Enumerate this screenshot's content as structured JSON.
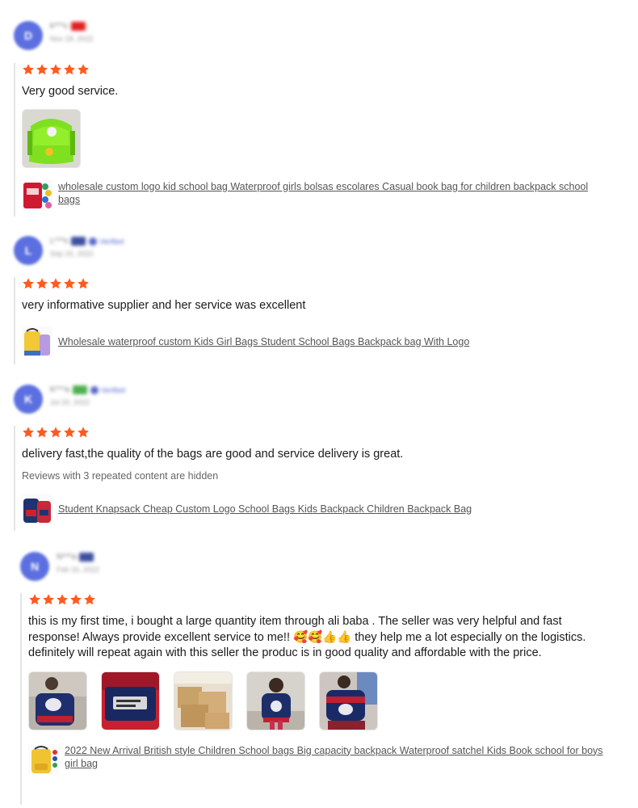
{
  "reviews": [
    {
      "avatar_letter": "D",
      "name": "k***s",
      "date": "Nov 18, 2022",
      "flag_color": "#e02020",
      "verified_badge": "",
      "rating": 5,
      "text": "Very good service.",
      "product_link": "wholesale custom logo kid school bag Waterproof girls bolsas escolares Casual book bag for children backpack school bags",
      "has_photos": true
    },
    {
      "avatar_letter": "L",
      "name": "L***s",
      "date": "Sep 15, 2022",
      "flag_color": "#3c4fa0",
      "verified_badge": "Verified",
      "rating": 5,
      "text": "very informative supplier and her service was excellent",
      "product_link": "Wholesale waterproof custom Kids Girl Bags Student School Bags Backpack bag With Logo"
    },
    {
      "avatar_letter": "K",
      "name": "K***a",
      "date": "Jul 20, 2022",
      "flag_color": "#4caf50",
      "verified_badge": "Verified",
      "rating": 5,
      "text": "delivery fast,the quality of the bags are good and service delivery is great.",
      "hidden_note": "Reviews with 3 repeated content are hidden",
      "product_link": "Student Knapsack Cheap Custom Logo School Bags Kids Backpack Children Backpack Bag"
    },
    {
      "avatar_letter": "N",
      "name": "N***a",
      "date": "Feb 16, 2022",
      "flag_color": "#3c4fa0",
      "verified_badge": "",
      "rating": 5,
      "text": "this is my first time, i bought a large quantity item through ali baba . The seller was very helpful and fast response! Always provide excellent service to me!! 🥰🥰👍👍 they help me a lot especially on the logistics. definitely will repeat again with this seller the produc is in good quality and affordable with the price.",
      "product_link": "2022 New Arrival British style Children School bags Big capacity backpack Waterproof satchel Kids Book school for boys girl bag",
      "photo_count": 5
    }
  ],
  "colors": {
    "star": "#ff5a1f",
    "avatar": "#5b6fe0",
    "link": "#555555"
  },
  "icons": {
    "star": "star-icon"
  }
}
